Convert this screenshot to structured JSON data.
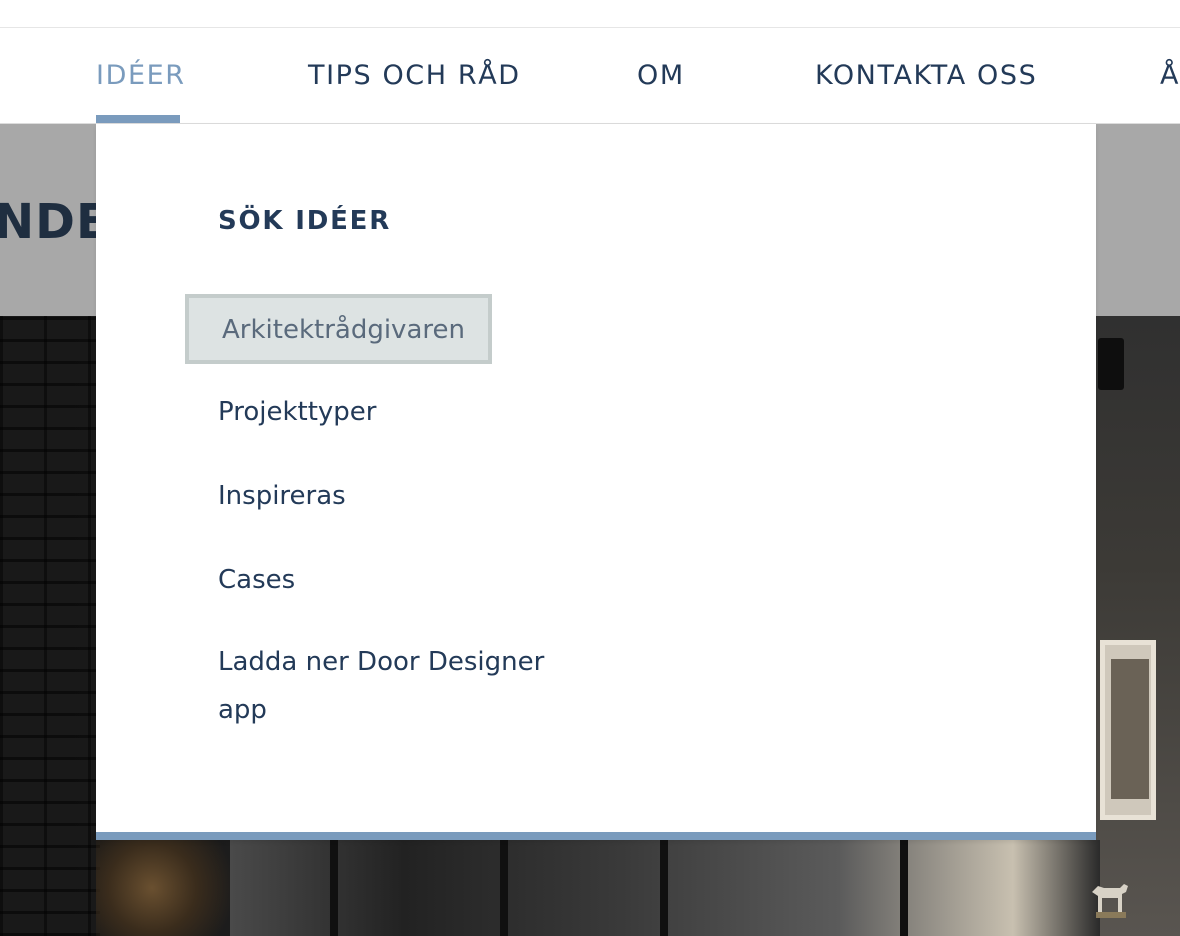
{
  "nav": {
    "items": [
      {
        "label": "IDÉER",
        "active": true
      },
      {
        "label": "TIPS OCH RÅD",
        "active": false
      },
      {
        "label": "OM",
        "active": false
      },
      {
        "label": "KONTAKTA OSS",
        "active": false
      },
      {
        "label": "Å",
        "active": false
      }
    ]
  },
  "hero": {
    "title_fragment": "NDE"
  },
  "dropdown": {
    "heading": "SÖK IDÉER",
    "items": [
      {
        "label": "Arkitektrådgivaren",
        "hovered": true
      },
      {
        "label": "Projekttyper"
      },
      {
        "label": "Inspireras"
      },
      {
        "label": "Cases"
      },
      {
        "label": "Ladda ner Door Designer app"
      }
    ]
  },
  "colors": {
    "nav_text": "#233a58",
    "accent": "#7a9bbd",
    "hover_bg": "#dde3e3",
    "hover_border": "#c4cccb"
  }
}
